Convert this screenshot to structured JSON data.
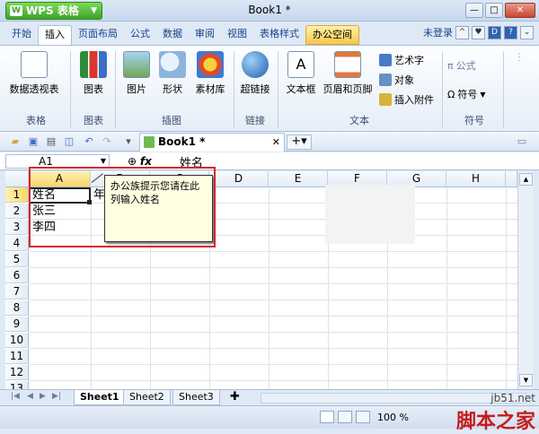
{
  "window": {
    "app_name": "WPS 表格",
    "title": "Book1 *"
  },
  "menu_tabs": [
    "开始",
    "插入",
    "页面布局",
    "公式",
    "数据",
    "审阅",
    "视图",
    "表格样式",
    "办公空间"
  ],
  "login_label": "未登录",
  "ribbon": {
    "buttons": {
      "pivot": "数据透视表",
      "chart": "图表",
      "picture": "图片",
      "shape": "形状",
      "gallery": "素材库",
      "hyperlink": "超链接",
      "textbox": "文本框",
      "header_footer": "页眉和页脚",
      "wordart": "艺术字",
      "object": "对象",
      "attachment": "插入附件",
      "formula": "公式",
      "symbol": "符号"
    },
    "groups": [
      "表格",
      "图表",
      "插图",
      "链接",
      "文本",
      "符号"
    ]
  },
  "doc_tab": "Book1 *",
  "formula_bar": {
    "cell_ref": "A1",
    "fx": "fx",
    "value": "姓名"
  },
  "columns": [
    "A",
    "B",
    "C",
    "D",
    "E",
    "F",
    "G",
    "H"
  ],
  "rows": [
    "1",
    "2",
    "3",
    "4",
    "5",
    "6",
    "7",
    "8",
    "9",
    "10",
    "11",
    "12",
    "13"
  ],
  "cells": {
    "a1": "姓名",
    "a2": "张三",
    "a3": "李四",
    "b1_partial": "年"
  },
  "tooltip": "办公族提示您请在此列输入姓名",
  "sheets": [
    "Sheet1",
    "Sheet2",
    "Sheet3"
  ],
  "status": {
    "zoom": "100 %"
  },
  "watermark": {
    "site": "jb51.net",
    "name": "脚本之家"
  }
}
